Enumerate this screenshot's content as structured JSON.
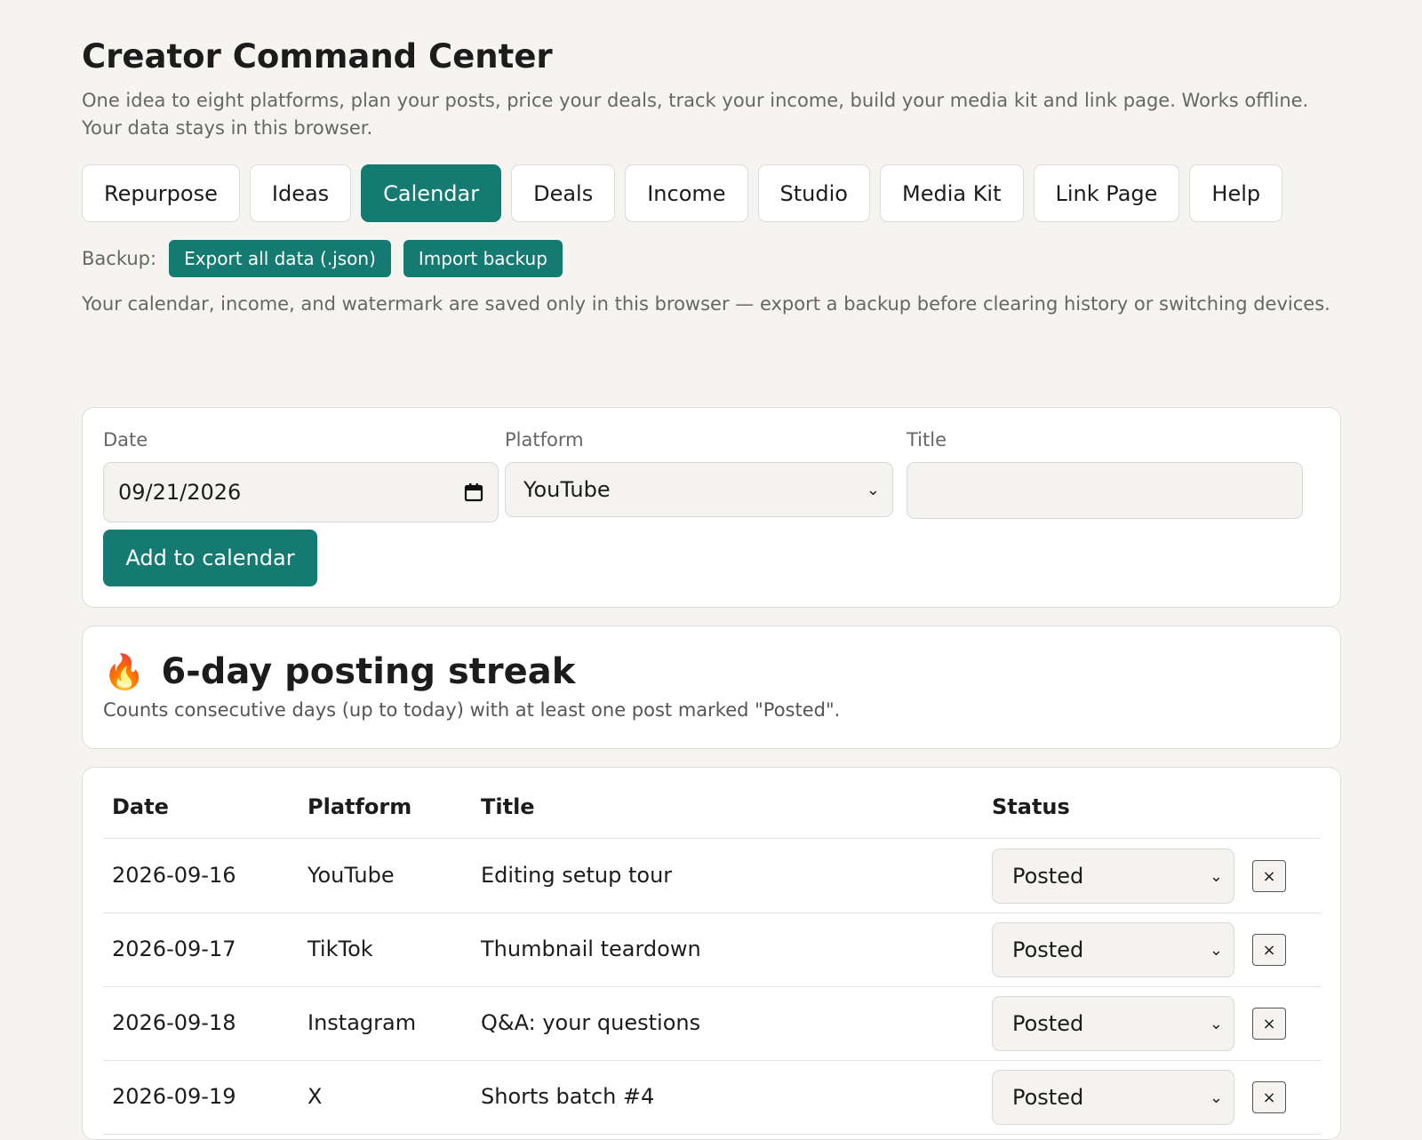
{
  "header": {
    "title": "Creator Command Center",
    "subtitle": "One idea to eight platforms, plan your posts, price your deals, track your income, build your media kit and link page. Works offline. Your data stays in this browser."
  },
  "tabs": [
    {
      "label": "Repurpose",
      "active": false
    },
    {
      "label": "Ideas",
      "active": false
    },
    {
      "label": "Calendar",
      "active": true
    },
    {
      "label": "Deals",
      "active": false
    },
    {
      "label": "Income",
      "active": false
    },
    {
      "label": "Studio",
      "active": false
    },
    {
      "label": "Media Kit",
      "active": false
    },
    {
      "label": "Link Page",
      "active": false
    },
    {
      "label": "Help",
      "active": false
    }
  ],
  "backup": {
    "label": "Backup:",
    "export_label": "Export all data (.json)",
    "import_label": "Import backup",
    "note": "Your calendar, income, and watermark are saved only in this browser — export a backup before clearing history or switching devices."
  },
  "form": {
    "date_label": "Date",
    "date_value": "09/21/2026",
    "platform_label": "Platform",
    "platform_value": "YouTube",
    "title_label": "Title",
    "title_value": "",
    "add_label": "Add to calendar"
  },
  "streak": {
    "icon": "🔥",
    "title": "6-day posting streak",
    "subtitle": "Counts consecutive days (up to today) with at least one post marked \"Posted\"."
  },
  "table": {
    "headers": {
      "date": "Date",
      "platform": "Platform",
      "title": "Title",
      "status": "Status"
    },
    "rows": [
      {
        "date": "2026-09-16",
        "platform": "YouTube",
        "title": "Editing setup tour",
        "status": "Posted",
        "delete": "×"
      },
      {
        "date": "2026-09-17",
        "platform": "TikTok",
        "title": "Thumbnail teardown",
        "status": "Posted",
        "delete": "×"
      },
      {
        "date": "2026-09-18",
        "platform": "Instagram",
        "title": "Q&A: your questions",
        "status": "Posted",
        "delete": "×"
      },
      {
        "date": "2026-09-19",
        "platform": "X",
        "title": "Shorts batch #4",
        "status": "Posted",
        "delete": "×"
      }
    ]
  },
  "colors": {
    "accent": "#157a72",
    "background": "#f5f4f0"
  }
}
